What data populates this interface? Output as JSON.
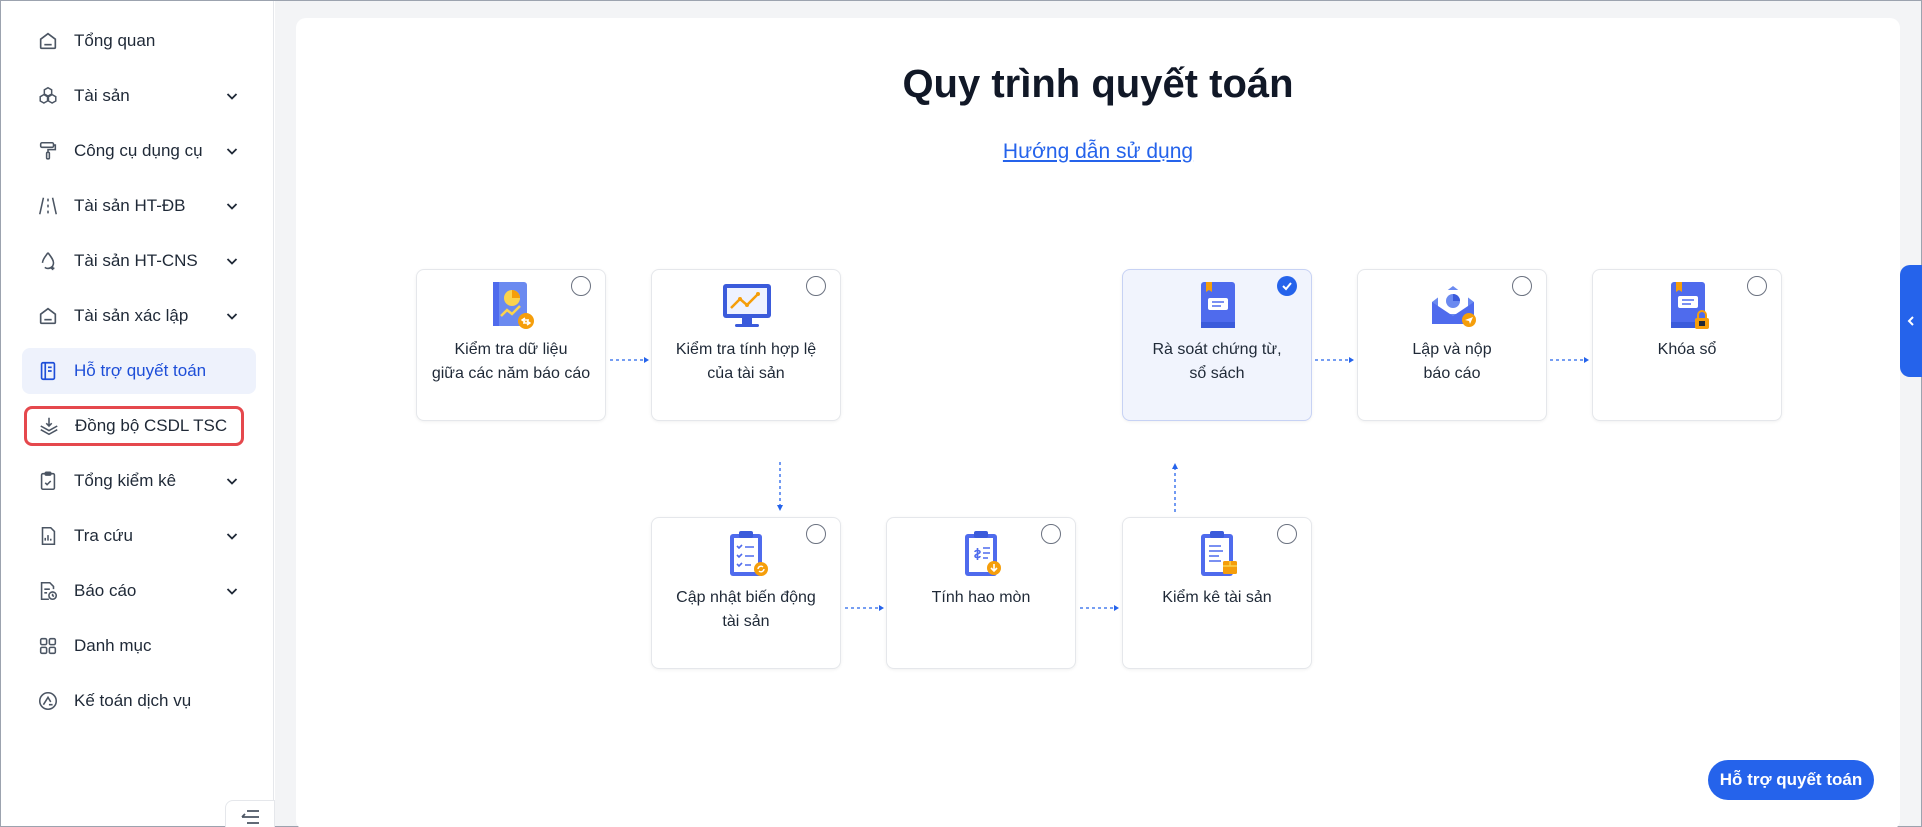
{
  "sidebar": {
    "items": [
      {
        "label": "Tổng quan",
        "icon": "home-icon",
        "has_children": false
      },
      {
        "label": "Tài sản",
        "icon": "assets-icon",
        "has_children": true
      },
      {
        "label": "Công cụ dụng cụ",
        "icon": "paint-roller-icon",
        "has_children": true
      },
      {
        "label": "Tài sản HT-ĐB",
        "icon": "road-icon",
        "has_children": true
      },
      {
        "label": "Tài sản HT-CNS",
        "icon": "water-drop-icon",
        "has_children": true
      },
      {
        "label": "Tài sản xác lập",
        "icon": "inbox-icon",
        "has_children": true
      },
      {
        "label": "Hỗ trợ quyết toán",
        "icon": "notebook-icon",
        "has_children": false,
        "active": true
      },
      {
        "label": "Đồng bộ CSDL TSC",
        "icon": "layers-sync-icon",
        "has_children": false,
        "highlighted": true
      },
      {
        "label": "Tổng kiểm kê",
        "icon": "clipboard-icon",
        "has_children": true
      },
      {
        "label": "Tra cứu",
        "icon": "report-search-icon",
        "has_children": true
      },
      {
        "label": "Báo cáo",
        "icon": "report-clock-icon",
        "has_children": true
      },
      {
        "label": "Danh mục",
        "icon": "grid-icon",
        "has_children": false
      },
      {
        "label": "Kế toán dịch vụ",
        "icon": "service-logo-icon",
        "has_children": false
      }
    ]
  },
  "main": {
    "title": "Quy trình quyết toán",
    "guide_link": "Hướng dẫn sử dụng",
    "steps": {
      "s1": {
        "line1": "Kiểm tra dữ liệu",
        "line2": "giữa các năm báo cáo",
        "checked": false
      },
      "s2": {
        "line1": "Kiểm tra tính hợp lệ",
        "line2": "của tài sản",
        "checked": false
      },
      "s3": {
        "line1": "Rà soát chứng từ,",
        "line2": "sổ sách",
        "checked": true
      },
      "s4": {
        "line1": "Lập và nộp",
        "line2": "báo cáo",
        "checked": false
      },
      "s5": {
        "line1": "Khóa sổ",
        "line2": "",
        "checked": false
      },
      "s6": {
        "line1": "Cập nhật biến động",
        "line2": "tài sản",
        "checked": false
      },
      "s7": {
        "line1": "Tính hao mòn",
        "line2": "",
        "checked": false
      },
      "s8": {
        "line1": "Kiểm kê tài sản",
        "line2": "",
        "checked": false
      }
    },
    "support_button": "Hỗ trợ quyết toán"
  },
  "colors": {
    "accent": "#2563eb",
    "active_bg": "#eef2fc",
    "highlight_border": "#e5484d",
    "icon_orange": "#f59e0b",
    "icon_blue": "#4f6bed"
  }
}
